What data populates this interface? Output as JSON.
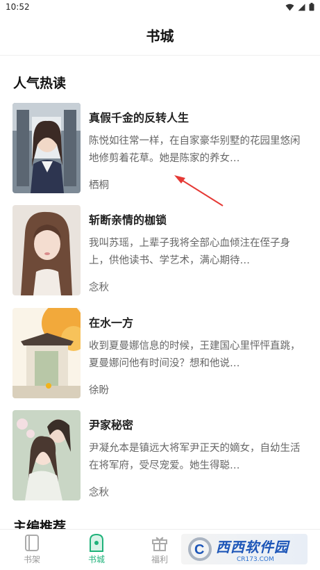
{
  "status_bar": {
    "time": "10:52"
  },
  "header": {
    "title": "书城"
  },
  "sections": {
    "popular": {
      "title": "人气热读"
    },
    "editor_picks": {
      "title": "主编推荐"
    }
  },
  "books": [
    {
      "title": "真假千金的反转人生",
      "description": "陈悦如往常一样，在自家豪华别墅的花园里悠闲地修剪着花草。她是陈家的养女…",
      "author": "栖桐"
    },
    {
      "title": "斩断亲情的枷锁",
      "description": "我叫苏瑶，上辈子我将全部心血倾注在侄子身上，供他读书、学艺术，满心期待…",
      "author": "念秋"
    },
    {
      "title": "在水一方",
      "description": "收到夏曼娜信息的时候，王建国心里怦怦直跳，夏曼娜问他有时间没？想和他说…",
      "author": "徐盼"
    },
    {
      "title": "尹家秘密",
      "description": "尹凝允本是镇远大将军尹正天的嫡女，自幼生活在将军府，受尽宠爱。她生得聪…",
      "author": "念秋"
    }
  ],
  "tabs": [
    {
      "label": "书架",
      "icon": "bookshelf-icon",
      "active": false
    },
    {
      "label": "书城",
      "icon": "bookstore-icon",
      "active": true
    },
    {
      "label": "福利",
      "icon": "gift-icon",
      "active": false
    }
  ],
  "watermark": {
    "main": "西西软件园",
    "sub": "CR173.COM",
    "logo_letter": "C"
  },
  "colors": {
    "accent": "#1fb27a",
    "annotation_arrow": "#e53935",
    "watermark_blue": "#1d56b8"
  }
}
